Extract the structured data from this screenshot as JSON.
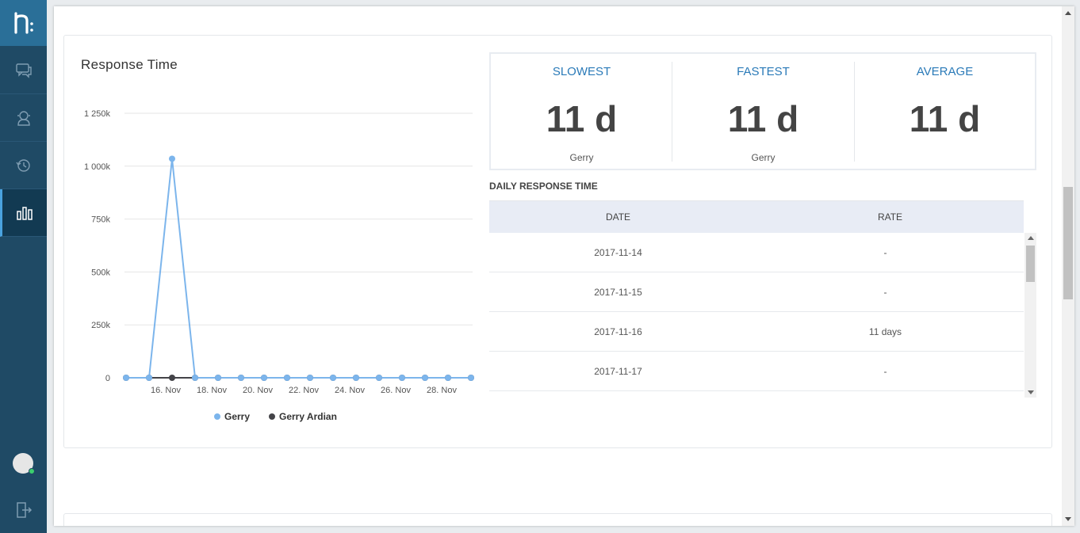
{
  "sidebar": {
    "items": [
      {
        "name": "chat",
        "icon": "chat-bubbles-icon"
      },
      {
        "name": "agents",
        "icon": "agent-icon"
      },
      {
        "name": "history",
        "icon": "history-icon"
      },
      {
        "name": "reports",
        "icon": "bar-chart-icon",
        "active": true
      }
    ]
  },
  "card": {
    "title": "Response Time"
  },
  "stats": {
    "slowest": {
      "label": "SLOWEST",
      "value": "11 d",
      "name": "Gerry"
    },
    "fastest": {
      "label": "FASTEST",
      "value": "11 d",
      "name": "Gerry"
    },
    "average": {
      "label": "AVERAGE",
      "value": "11 d",
      "name": ""
    }
  },
  "daily": {
    "title": "DAILY RESPONSE TIME",
    "columns": [
      "DATE",
      "RATE"
    ],
    "rows": [
      {
        "date": "2017-11-14",
        "rate": "-"
      },
      {
        "date": "2017-11-15",
        "rate": "-"
      },
      {
        "date": "2017-11-16",
        "rate": "11 days"
      },
      {
        "date": "2017-11-17",
        "rate": "-"
      }
    ]
  },
  "chart_data": {
    "type": "line",
    "title": "",
    "xlabel": "",
    "ylabel": "",
    "ylim": [
      0,
      1250000
    ],
    "yticks": [
      0,
      250000,
      500000,
      750000,
      1000000,
      1250000
    ],
    "ytick_labels": [
      "0",
      "250k",
      "500k",
      "750k",
      "1 000k",
      "1 250k"
    ],
    "x": [
      "2017-11-14",
      "2017-11-15",
      "2017-11-16",
      "2017-11-17",
      "2017-11-18",
      "2017-11-19",
      "2017-11-20",
      "2017-11-21",
      "2017-11-22",
      "2017-11-23",
      "2017-11-24",
      "2017-11-25",
      "2017-11-26",
      "2017-11-27",
      "2017-11-28",
      "2017-11-29"
    ],
    "xtick_labels": [
      {
        "date": "2017-11-16",
        "label": "16. Nov"
      },
      {
        "date": "2017-11-18",
        "label": "18. Nov"
      },
      {
        "date": "2017-11-20",
        "label": "20. Nov"
      },
      {
        "date": "2017-11-22",
        "label": "22. Nov"
      },
      {
        "date": "2017-11-24",
        "label": "24. Nov"
      },
      {
        "date": "2017-11-26",
        "label": "26. Nov"
      },
      {
        "date": "2017-11-28",
        "label": "28. Nov"
      }
    ],
    "series": [
      {
        "name": "Gerry",
        "color": "#7cb5ec",
        "values": [
          0,
          0,
          1035000,
          0,
          0,
          0,
          0,
          0,
          0,
          0,
          0,
          0,
          0,
          0,
          0,
          0
        ]
      },
      {
        "name": "Gerry Ardian",
        "color": "#434348",
        "values": [
          0,
          0,
          0,
          0,
          0,
          0,
          0,
          0,
          0,
          0,
          0,
          0,
          0,
          0,
          0,
          0
        ]
      }
    ],
    "grid": true,
    "legend": "bottom-center"
  }
}
